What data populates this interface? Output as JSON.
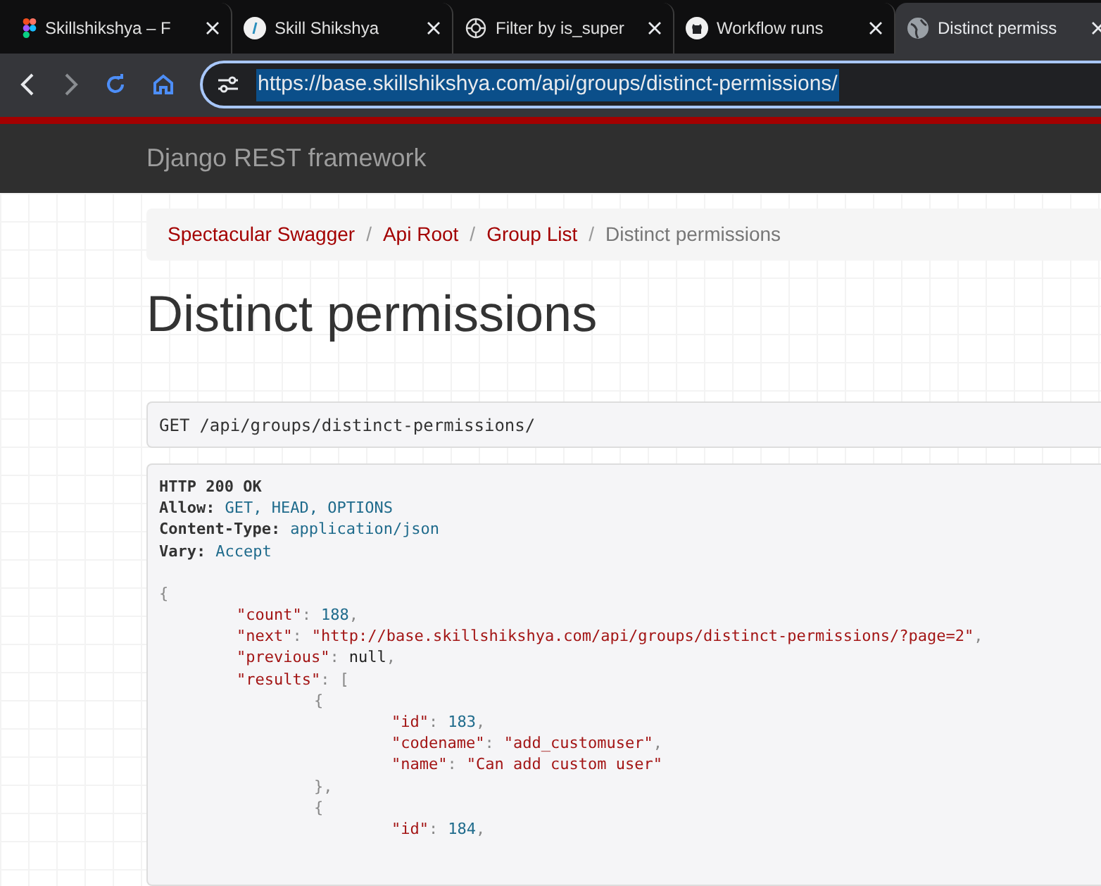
{
  "browser": {
    "tabs": [
      {
        "title": "Skillshikshya – F",
        "selected": false
      },
      {
        "title": "Skill Shikshya",
        "selected": false
      },
      {
        "title": "Filter by is_super",
        "selected": false
      },
      {
        "title": "Workflow runs",
        "selected": false
      },
      {
        "title": "Distinct permiss",
        "selected": true
      }
    ],
    "address": "https://base.skillshikshya.com/api/groups/distinct-permissions/"
  },
  "navbar": {
    "brand": "Django REST framework"
  },
  "breadcrumbs": [
    {
      "label": "Spectacular Swagger",
      "current": false
    },
    {
      "separator": "/",
      "label": "Api Root",
      "current": false
    },
    {
      "separator": "/",
      "label": "Group List",
      "current": false
    },
    {
      "separator": "/",
      "label": "Distinct permissions",
      "current": true
    }
  ],
  "page_title": "Distinct permissions",
  "request": {
    "method": "GET",
    "path": "/api/groups/distinct-permissions/"
  },
  "response": {
    "status": "HTTP 200 OK",
    "headers": [
      {
        "name": "Allow:",
        "value": "GET, HEAD, OPTIONS"
      },
      {
        "name": "Content-Type:",
        "value": "application/json"
      },
      {
        "name": "Vary:",
        "value": "Accept"
      }
    ],
    "body": {
      "open": "{",
      "children": [
        {
          "key": "\"count\"",
          "sep": ":",
          "value": "188",
          "kind": "number",
          "end": ","
        },
        {
          "key": "\"next\"",
          "sep": ":",
          "value": "\"http://base.skillshikshya.com/api/groups/distinct-permissions/?page=2\"",
          "kind": "string",
          "end": ","
        },
        {
          "key": "\"previous\"",
          "sep": ":",
          "value": "null",
          "kind": "literal",
          "end": ","
        },
        {
          "key": "\"results\"",
          "sep": ":",
          "open": "[",
          "children": [
            {
              "open": "{",
              "children": [
                {
                  "key": "\"id\"",
                  "sep": ":",
                  "value": "183",
                  "kind": "number",
                  "end": ","
                },
                {
                  "key": "\"codename\"",
                  "sep": ":",
                  "value": "\"add_customuser\"",
                  "kind": "string",
                  "end": ","
                },
                {
                  "key": "\"name\"",
                  "sep": ":",
                  "value": "\"Can add custom user\"",
                  "kind": "string"
                }
              ],
              "close": "},"
            },
            {
              "open": "{",
              "children": [
                {
                  "key": "\"id\"",
                  "sep": ":",
                  "value": "184",
                  "kind": "number",
                  "end": ","
                }
              ]
            }
          ]
        }
      ]
    }
  }
}
